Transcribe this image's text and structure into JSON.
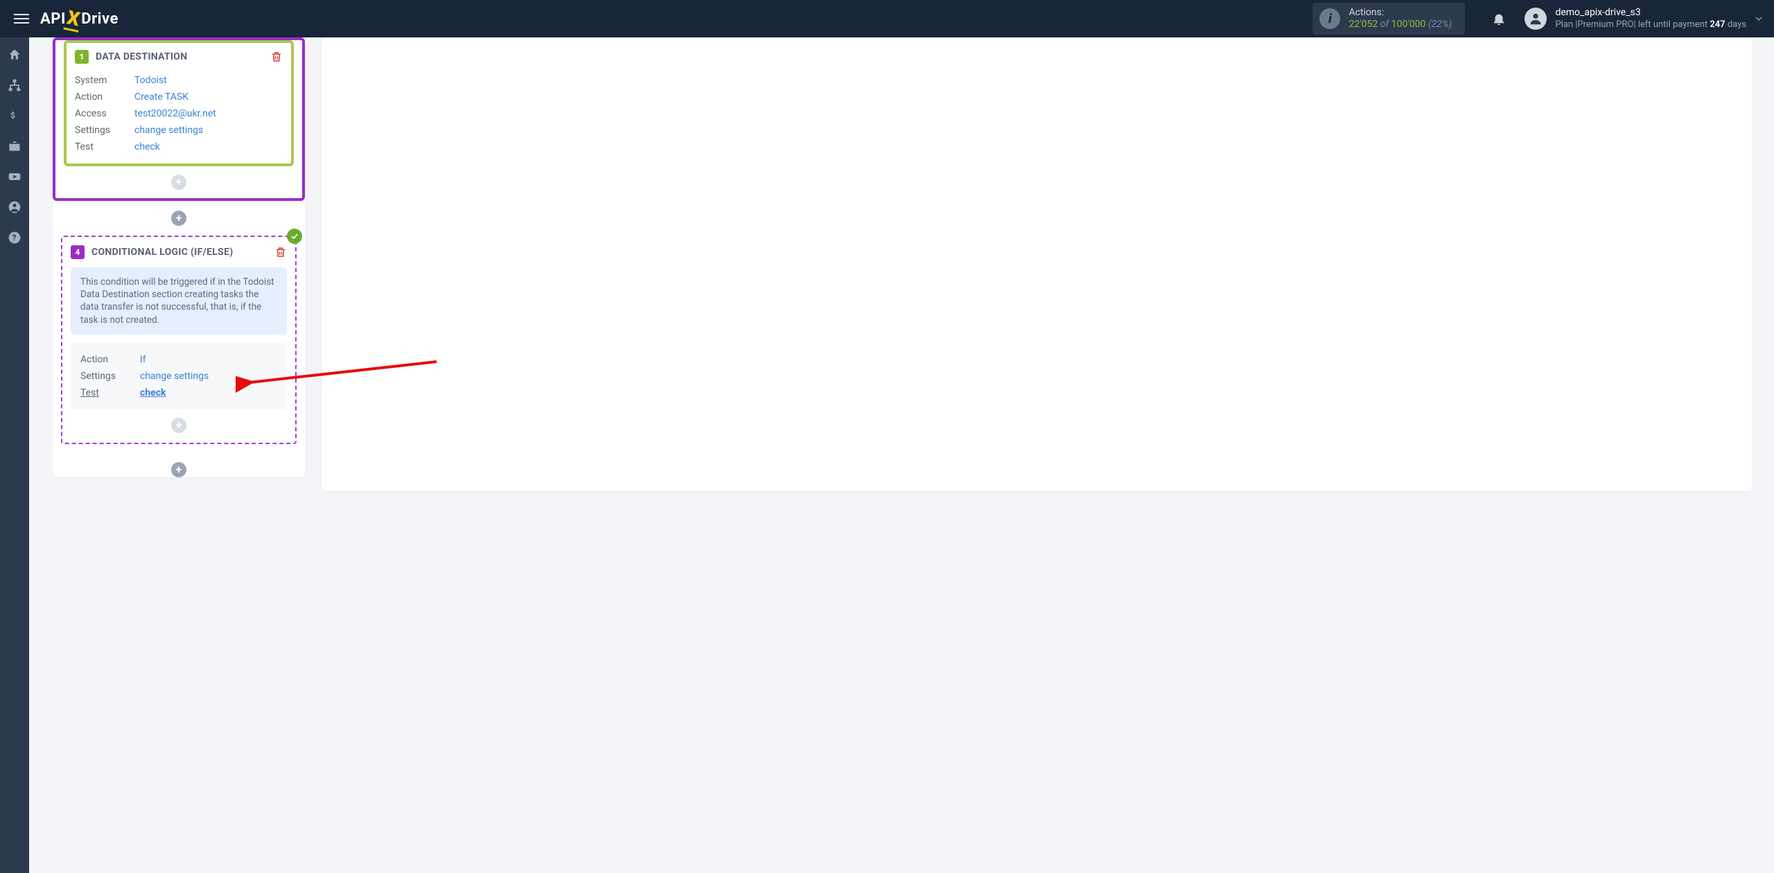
{
  "header": {
    "logo": {
      "p1": "API",
      "x": "X",
      "p2": "Drive"
    },
    "actions": {
      "label": "Actions:",
      "count": "22'052",
      "of": "of",
      "limit": "100'000",
      "pct": "(22%)"
    },
    "user": {
      "name": "demo_apix-drive_s3",
      "plan_prefix": "Plan |Premium PRO| left until payment ",
      "days": "247",
      "days_suffix": " days"
    }
  },
  "step_dest": {
    "badge": "1",
    "title": "DATA DESTINATION",
    "rows": {
      "system_k": "System",
      "system_v": "Todoist",
      "action_k": "Action",
      "action_v": "Create TASK",
      "access_k": "Access",
      "access_v": "test20022@ukr.net",
      "settings_k": "Settings",
      "settings_v": "change settings",
      "test_k": "Test",
      "test_v": "check"
    }
  },
  "step_cond": {
    "badge": "4",
    "title": "CONDITIONAL LOGIC (IF/ELSE)",
    "info": "This condition will be triggered if in the Todoist Data Destination section creating tasks the data transfer is not successful, that is, if the task is not created.",
    "rows": {
      "action_k": "Action",
      "action_v": "If",
      "settings_k": "Settings",
      "settings_v": "change settings",
      "test_k": "Test",
      "test_v": "check"
    }
  }
}
